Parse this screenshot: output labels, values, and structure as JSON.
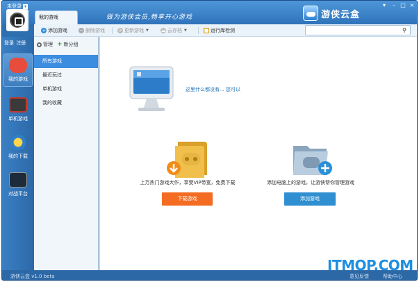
{
  "titlebar": {
    "user_status": "未登录",
    "tab_label": "我的游戏",
    "slogan": "做为游侠会员,畅享开心游戏",
    "brand_name": "游侠云盒"
  },
  "toolbar": {
    "add_game": "添加游戏",
    "delete_game": "删除游戏",
    "update_game": "更新游戏",
    "cloud_save": "云存档",
    "runtime_check": "运行库检测"
  },
  "search": {
    "placeholder": ""
  },
  "leftbar": {
    "login": "登录",
    "register": "注册",
    "items": [
      {
        "label": "我的游戏"
      },
      {
        "label": "单机游戏"
      },
      {
        "label": "我的下载"
      },
      {
        "label": "对战平台"
      }
    ]
  },
  "sidebar": {
    "manage": "管理",
    "new_group": "新分组",
    "categories": [
      "所有游戏",
      "最近玩过",
      "单机游戏",
      "我的收藏"
    ]
  },
  "main": {
    "empty_message": "这里什么都没有... 您可以",
    "download_desc": "上万热门游戏大作，享受VIP带宽，免费下载",
    "download_button": "下载游戏",
    "add_desc": "添加电脑上的游戏，让游侠帮你管理游戏",
    "add_button": "添加游戏"
  },
  "statusbar": {
    "version": "游侠云盒 v1.0 beta",
    "feedback": "意见反馈",
    "help": "帮助中心"
  },
  "watermark": "ITMOP.COM",
  "colors": {
    "accent": "#3b8de0",
    "download_button": "#f36c21",
    "add_button": "#2f8fd0"
  }
}
